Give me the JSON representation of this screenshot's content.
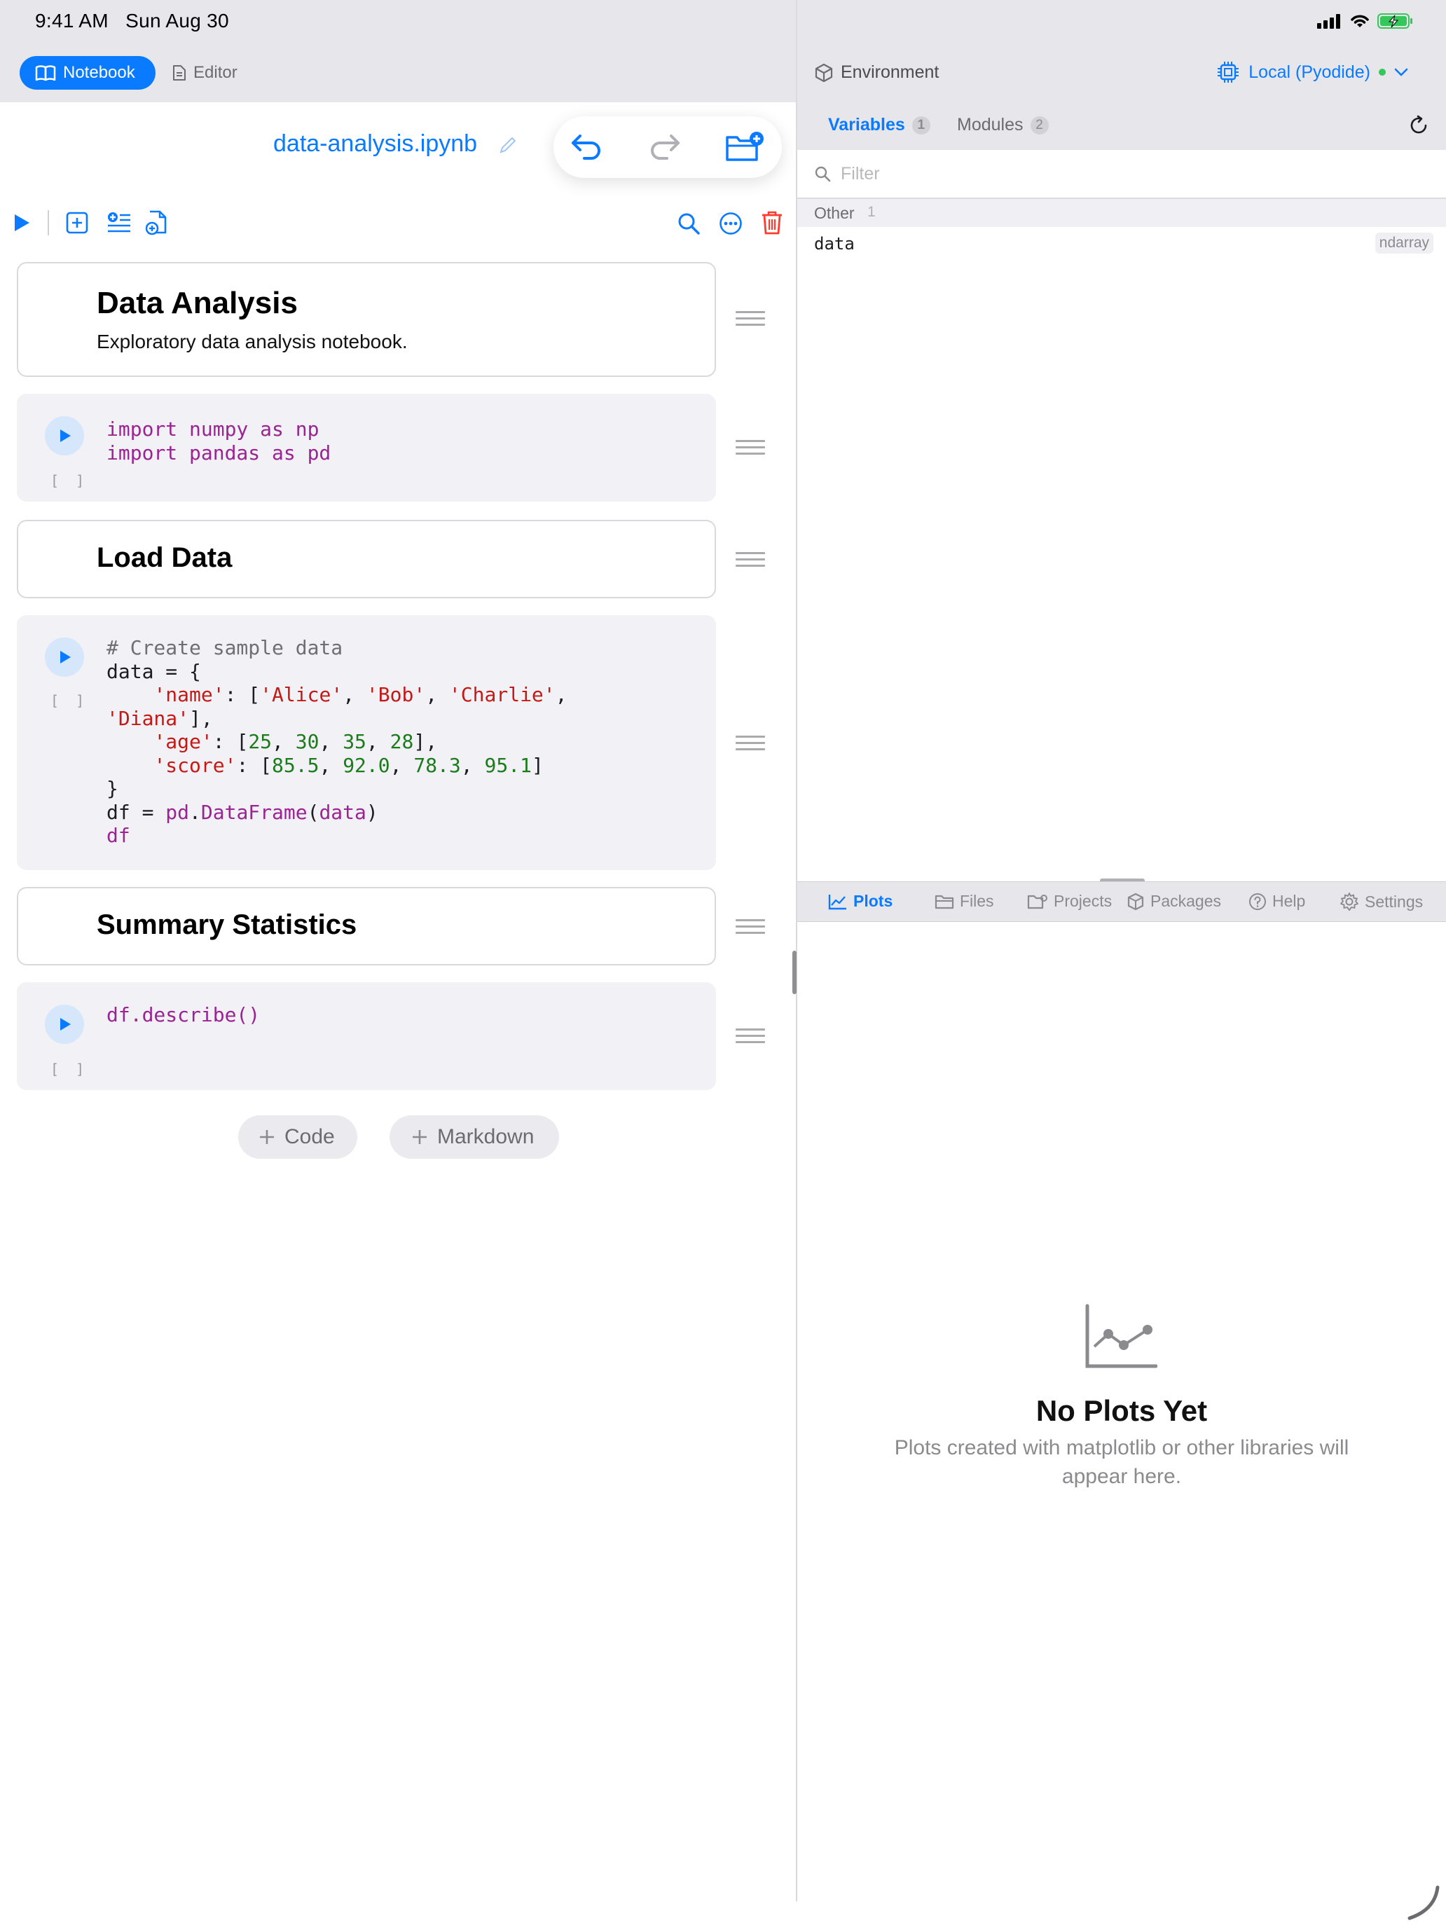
{
  "status_bar": {
    "time": "9:41 AM",
    "date": "Sun Aug 30"
  },
  "left_header": {
    "tabs": [
      {
        "label": "Notebook",
        "icon": "book-icon"
      },
      {
        "label": "Editor",
        "icon": "document-icon"
      }
    ]
  },
  "notebook": {
    "title": "data-analysis.ipynb",
    "cells": [
      {
        "type": "markdown",
        "heading": "Data Analysis",
        "text": "Exploratory data analysis notebook."
      },
      {
        "type": "code",
        "exec": "[ ]",
        "lines": [
          "import numpy as np",
          "import pandas as pd"
        ]
      },
      {
        "type": "markdown",
        "heading": "Load Data"
      },
      {
        "type": "code",
        "exec": "[ ]",
        "lines": [
          "# Create sample data",
          "data = {",
          "    'name': ['Alice', 'Bob', 'Charlie',",
          "'Diana'],",
          "    'age': [25, 30, 35, 28],",
          "    'score': [85.5, 92.0, 78.3, 95.1]",
          "}",
          "df = pd.DataFrame(data)",
          "df"
        ]
      },
      {
        "type": "markdown",
        "heading": "Summary Statistics"
      },
      {
        "type": "code",
        "exec": "[ ]",
        "lines": [
          "df.describe()"
        ]
      }
    ],
    "add_code_label": "Code",
    "add_markdown_label": "Markdown"
  },
  "environment": {
    "label": "Environment",
    "runtime": "Local (Pyodide)",
    "runtime_status_color": "#34c759",
    "tabs": [
      {
        "label": "Variables",
        "count": "1"
      },
      {
        "label": "Modules",
        "count": "2"
      }
    ],
    "filter_placeholder": "Filter",
    "groups": [
      {
        "name": "Other",
        "count": "1",
        "variables": [
          {
            "name": "data",
            "type": "ndarray"
          }
        ]
      }
    ]
  },
  "bottom_panel": {
    "tabs": [
      {
        "label": "Plots",
        "icon": "chart-icon",
        "active": true
      },
      {
        "label": "Files",
        "icon": "folder-icon"
      },
      {
        "label": "Projects",
        "icon": "projects-icon"
      },
      {
        "label": "Packages",
        "icon": "package-icon"
      },
      {
        "label": "Help",
        "icon": "help-icon"
      },
      {
        "label": "Settings",
        "icon": "gear-icon"
      }
    ],
    "empty_title": "No Plots Yet",
    "empty_desc_line1": "Plots created with matplotlib or other libraries will",
    "empty_desc_line2": "appear here."
  },
  "colors": {
    "accent": "#0a7aff",
    "delete": "#ff3b30"
  }
}
